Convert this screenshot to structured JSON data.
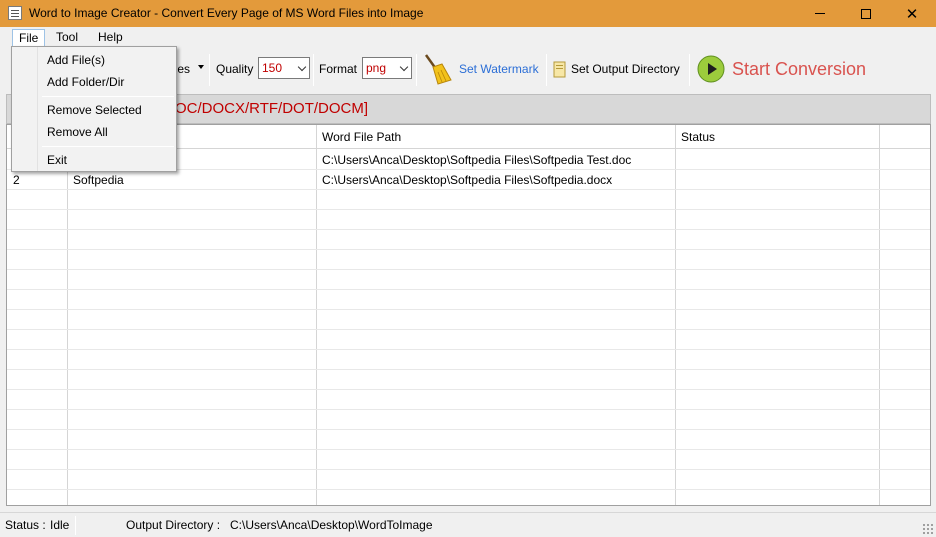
{
  "window": {
    "title": "Word to Image Creator - Convert Every Page of MS Word Files into Image",
    "minimize_glyph": "—",
    "maximize_glyph": "☐",
    "close_glyph": "✕"
  },
  "menubar": {
    "file": "File",
    "tool": "Tool",
    "help": "Help"
  },
  "file_menu": {
    "items": [
      "Add File(s)",
      "Add Folder/Dir",
      "Remove Selected",
      "Remove All",
      "Exit"
    ]
  },
  "toolbar": {
    "hidden_files_label": "iles",
    "quality_label": "Quality",
    "quality_value": "150",
    "format_label": "Format",
    "format_value": "png",
    "set_watermark": "Set Watermark",
    "set_output_directory": "Set Output Directory",
    "start_conversion": "Start Conversion"
  },
  "drop_banner": {
    "text": "OC/DOCX/RTF/DOT/DOCM]"
  },
  "grid": {
    "columns": [
      "",
      "",
      "Word File Path",
      "Status"
    ],
    "rows": [
      {
        "index": "",
        "name": "",
        "path": "C:\\Users\\Anca\\Desktop\\Softpedia Files\\Softpedia Test.doc",
        "status": ""
      },
      {
        "index": "2",
        "name": "Softpedia",
        "path": "C:\\Users\\Anca\\Desktop\\Softpedia Files\\Softpedia.docx",
        "status": ""
      }
    ]
  },
  "statusbar": {
    "status_label": "Status :",
    "status_value": "Idle",
    "output_label": "Output Directory :",
    "output_value": "C:\\Users\\Anca\\Desktop\\WordToImage"
  },
  "colors": {
    "titlebar": "#e39a3b",
    "accent_red": "#c00000",
    "start_red": "#d9534f",
    "link_blue": "#2b6ed6"
  }
}
